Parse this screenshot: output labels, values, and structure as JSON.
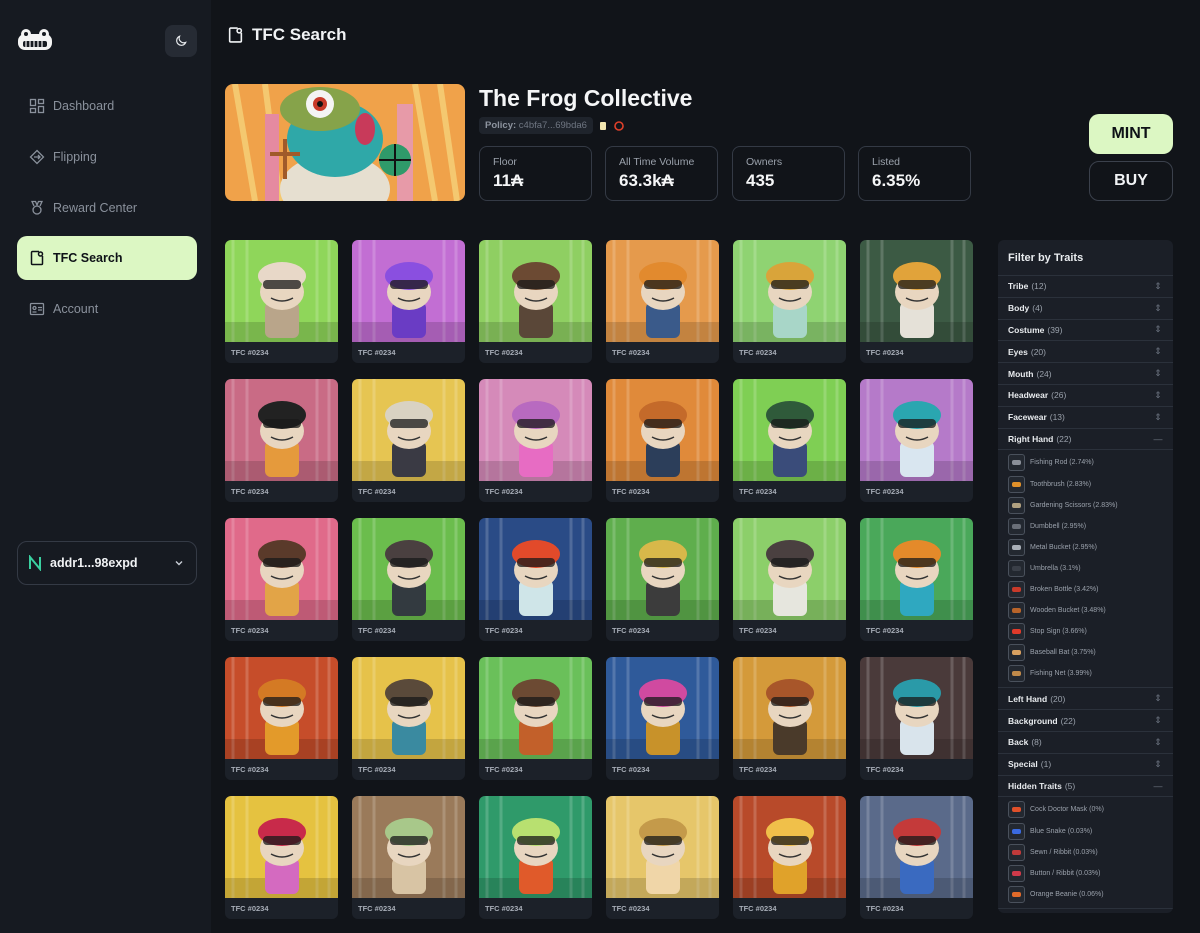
{
  "app": {
    "page_title": "TFC Search"
  },
  "nav": {
    "items": [
      {
        "label": "Dashboard",
        "icon": "dashboard-icon"
      },
      {
        "label": "Flipping",
        "icon": "flipping-icon"
      },
      {
        "label": "Reward Center",
        "icon": "reward-icon"
      },
      {
        "label": "TFC Search",
        "icon": "search-doc-icon",
        "active": true
      },
      {
        "label": "Account",
        "icon": "account-icon"
      }
    ]
  },
  "wallet": {
    "address": "addr1...98expd"
  },
  "collection": {
    "name": "The Frog Collective",
    "policy_label": "Policy:",
    "policy_id": "c4bfa7...69bda6"
  },
  "stats": [
    {
      "label": "Floor",
      "value": "11₳"
    },
    {
      "label": "All Time Volume",
      "value": "63.3k₳"
    },
    {
      "label": "Owners",
      "value": "435"
    },
    {
      "label": "Listed",
      "value": "6.35%"
    }
  ],
  "actions": {
    "mint": "MINT",
    "buy": "BUY"
  },
  "nfts": [
    {
      "label": "TFC #0234",
      "bg": "#8fd65a",
      "body": "#b9a58a",
      "hat": "#e8d8c8"
    },
    {
      "label": "TFC #0234",
      "bg": "#c26ed3",
      "body": "#6a3cc4",
      "hat": "#8a4fe0"
    },
    {
      "label": "TFC #0234",
      "bg": "#8fcf62",
      "body": "#5a4738",
      "hat": "#6c4a33"
    },
    {
      "label": "TFC #0234",
      "bg": "#e59a4c",
      "body": "#3a5a8a",
      "hat": "#e28a2e"
    },
    {
      "label": "TFC #0234",
      "bg": "#8fd372",
      "body": "#a8d6c8",
      "hat": "#d9a43a"
    },
    {
      "label": "TFC #0234",
      "bg": "#3c5a44",
      "body": "#e5e1d8",
      "hat": "#e1a33a"
    },
    {
      "label": "TFC #0234",
      "bg": "#c96b85",
      "body": "#e59a3c",
      "hat": "#222222"
    },
    {
      "label": "TFC #0234",
      "bg": "#e6c552",
      "body": "#3a3a44",
      "hat": "#d9d2c2"
    },
    {
      "label": "TFC #0234",
      "bg": "#d58ab9",
      "body": "#e76cc3",
      "hat": "#b86ac0"
    },
    {
      "label": "TFC #0234",
      "bg": "#e08a3a",
      "body": "#2c3e5a",
      "hat": "#c46a2a"
    },
    {
      "label": "TFC #0234",
      "bg": "#7fcf54",
      "body": "#3a4c7a",
      "hat": "#2f5a3a"
    },
    {
      "label": "TFC #0234",
      "bg": "#b57ac9",
      "body": "#d9e6f0",
      "hat": "#2aa6b0"
    },
    {
      "label": "TFC #0234",
      "bg": "#e06a8a",
      "body": "#e2a447",
      "hat": "#5a3a2a"
    },
    {
      "label": "TFC #0234",
      "bg": "#6bbd4d",
      "body": "#333a40",
      "hat": "#4a4040"
    },
    {
      "label": "TFC #0234",
      "bg": "#2a4b86",
      "body": "#cfe5e8",
      "hat": "#e24a2a"
    },
    {
      "label": "TFC #0234",
      "bg": "#5fae4d",
      "body": "#3c3c3c",
      "hat": "#d8b84a"
    },
    {
      "label": "TFC #0234",
      "bg": "#8ccf6a",
      "body": "#e6e6de",
      "hat": "#4a4040"
    },
    {
      "label": "TFC #0234",
      "bg": "#4aa85a",
      "body": "#2fa8c0",
      "hat": "#e48a2a"
    },
    {
      "label": "TFC #0234",
      "bg": "#c64d2a",
      "body": "#e39a2a",
      "hat": "#d47a24"
    },
    {
      "label": "TFC #0234",
      "bg": "#e6c24a",
      "body": "#3a8aa0",
      "hat": "#5a4a3a"
    },
    {
      "label": "TFC #0234",
      "bg": "#6ac05a",
      "body": "#c2602a",
      "hat": "#6c4a33"
    },
    {
      "label": "TFC #0234",
      "bg": "#2f5a9a",
      "body": "#c8922a",
      "hat": "#d04aa0"
    },
    {
      "label": "TFC #0234",
      "bg": "#d49a3a",
      "body": "#4a3a2a",
      "hat": "#a8562a"
    },
    {
      "label": "TFC #0234",
      "bg": "#4a3a3a",
      "body": "#d9e4ec",
      "hat": "#2a9aa8"
    },
    {
      "label": "TFC #0234",
      "bg": "#e5c240",
      "body": "#d46ac0",
      "hat": "#c82a4a"
    },
    {
      "label": "TFC #0234",
      "bg": "#9a7a5a",
      "body": "#d8c4a4",
      "hat": "#a8c88a"
    },
    {
      "label": "TFC #0234",
      "bg": "#2f9a6a",
      "body": "#e05a2a",
      "hat": "#b8e070"
    },
    {
      "label": "TFC #0234",
      "bg": "#e6c66a",
      "body": "#f0d6a8",
      "hat": "#c49a4a"
    },
    {
      "label": "TFC #0234",
      "bg": "#b84a2a",
      "body": "#e0a22a",
      "hat": "#f0c04a"
    },
    {
      "label": "TFC #0234",
      "bg": "#5a6a8a",
      "body": "#3a6ac0",
      "hat": "#c43a3a"
    }
  ],
  "filter": {
    "title": "Filter by Traits",
    "traits_top": [
      {
        "name": "Tribe",
        "count": "(12)"
      },
      {
        "name": "Body",
        "count": "(4)"
      },
      {
        "name": "Costume",
        "count": "(39)"
      },
      {
        "name": "Eyes",
        "count": "(20)"
      },
      {
        "name": "Mouth",
        "count": "(24)"
      },
      {
        "name": "Headwear",
        "count": "(26)"
      },
      {
        "name": "Facewear",
        "count": "(13)"
      }
    ],
    "right_hand": {
      "name": "Right Hand",
      "count": "(22)",
      "items": [
        {
          "label": "Fishing Rod (2.74%)",
          "color": "#8a8f98"
        },
        {
          "label": "Toothbrush (2.83%)",
          "color": "#e0902a"
        },
        {
          "label": "Gardening Scissors (2.83%)",
          "color": "#b0a080"
        },
        {
          "label": "Dumbbell (2.95%)",
          "color": "#6a6f78"
        },
        {
          "label": "Metal Bucket (2.95%)",
          "color": "#a8aeb6"
        },
        {
          "label": "Umbrella (3.1%)",
          "color": "#3a3f48"
        },
        {
          "label": "Broken Bottle (3.42%)",
          "color": "#c83a2a"
        },
        {
          "label": "Wooden Bucket (3.48%)",
          "color": "#b8642a"
        },
        {
          "label": "Stop Sign (3.66%)",
          "color": "#e03a2a"
        },
        {
          "label": "Baseball Bat (3.75%)",
          "color": "#d8a060"
        },
        {
          "label": "Fishing Net (3.99%)",
          "color": "#c08a4a"
        }
      ]
    },
    "traits_mid": [
      {
        "name": "Left Hand",
        "count": "(20)"
      },
      {
        "name": "Background",
        "count": "(22)"
      },
      {
        "name": "Back",
        "count": "(8)"
      },
      {
        "name": "Special",
        "count": "(1)"
      }
    ],
    "hidden": {
      "name": "Hidden Traits",
      "count": "(5)",
      "items": [
        {
          "label": "Cock Doctor Mask (0%)",
          "color": "#e0502a"
        },
        {
          "label": "Blue Snake (0.03%)",
          "color": "#3a6ae0"
        },
        {
          "label": "Sewn / Ribbit (0.03%)",
          "color": "#c03a3a"
        },
        {
          "label": "Button / Ribbit (0.03%)",
          "color": "#d03a4a"
        },
        {
          "label": "Orange Beanie (0.06%)",
          "color": "#e06a2a"
        }
      ]
    }
  }
}
